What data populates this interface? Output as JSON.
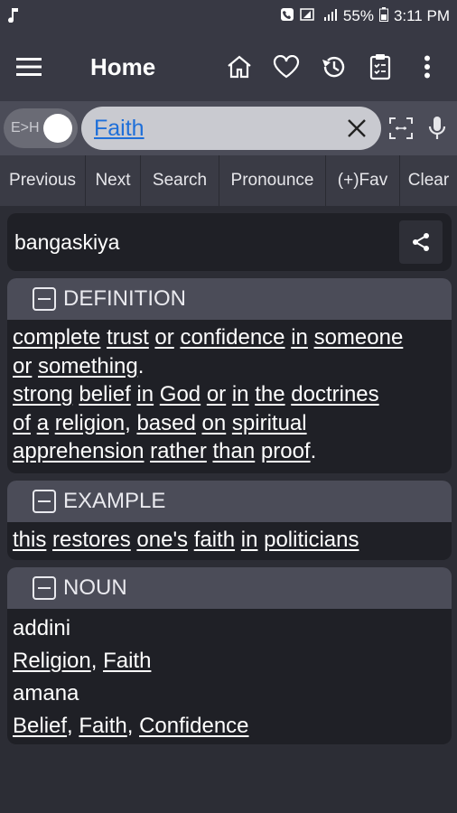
{
  "status": {
    "left_icon": "music-note",
    "battery": "55%",
    "time": "3:11 PM"
  },
  "appbar": {
    "title": "Home",
    "icons": [
      "menu-icon",
      "home-icon",
      "heart-icon",
      "history-icon",
      "clipboard-icon",
      "more-vert-icon"
    ]
  },
  "search": {
    "toggle_label": "E>H",
    "query": "Faith"
  },
  "buttons": {
    "previous": "Previous",
    "next": "Next",
    "search": "Search",
    "pronounce": "Pronounce",
    "fav": "(+)Fav",
    "clear": "Clear"
  },
  "word": {
    "translation": "bangaskiya"
  },
  "definition": {
    "heading": "DEFINITION",
    "line1": [
      "complete",
      "trust",
      "or",
      "confidence",
      "in",
      "someone"
    ],
    "line2": [
      "or",
      "something",
      "."
    ],
    "line3": [
      "strong",
      "belief",
      "in",
      "God",
      "or",
      "in",
      "the",
      "doctrines"
    ],
    "line4": [
      "of",
      "a",
      "religion",
      ",",
      "based",
      "on",
      "spiritual"
    ],
    "line5": [
      "apprehension",
      "rather",
      "than",
      "proof",
      "."
    ]
  },
  "example": {
    "heading": "EXAMPLE",
    "words": [
      "this",
      "restores",
      "one's",
      "faith",
      "in",
      "politicians"
    ]
  },
  "noun": {
    "heading": "NOUN",
    "entry1": "addini",
    "entry1_syn": [
      "Religion",
      ",",
      "Faith"
    ],
    "entry2": "amana",
    "entry2_syn": [
      "Belief",
      ",",
      "Faith",
      ",",
      "Confidence"
    ]
  },
  "colors": {
    "background": "#2c2d35",
    "bar": "#383944",
    "section_header": "#4b4c58",
    "card": "#1f2026",
    "query_text": "#1e6fd9"
  }
}
